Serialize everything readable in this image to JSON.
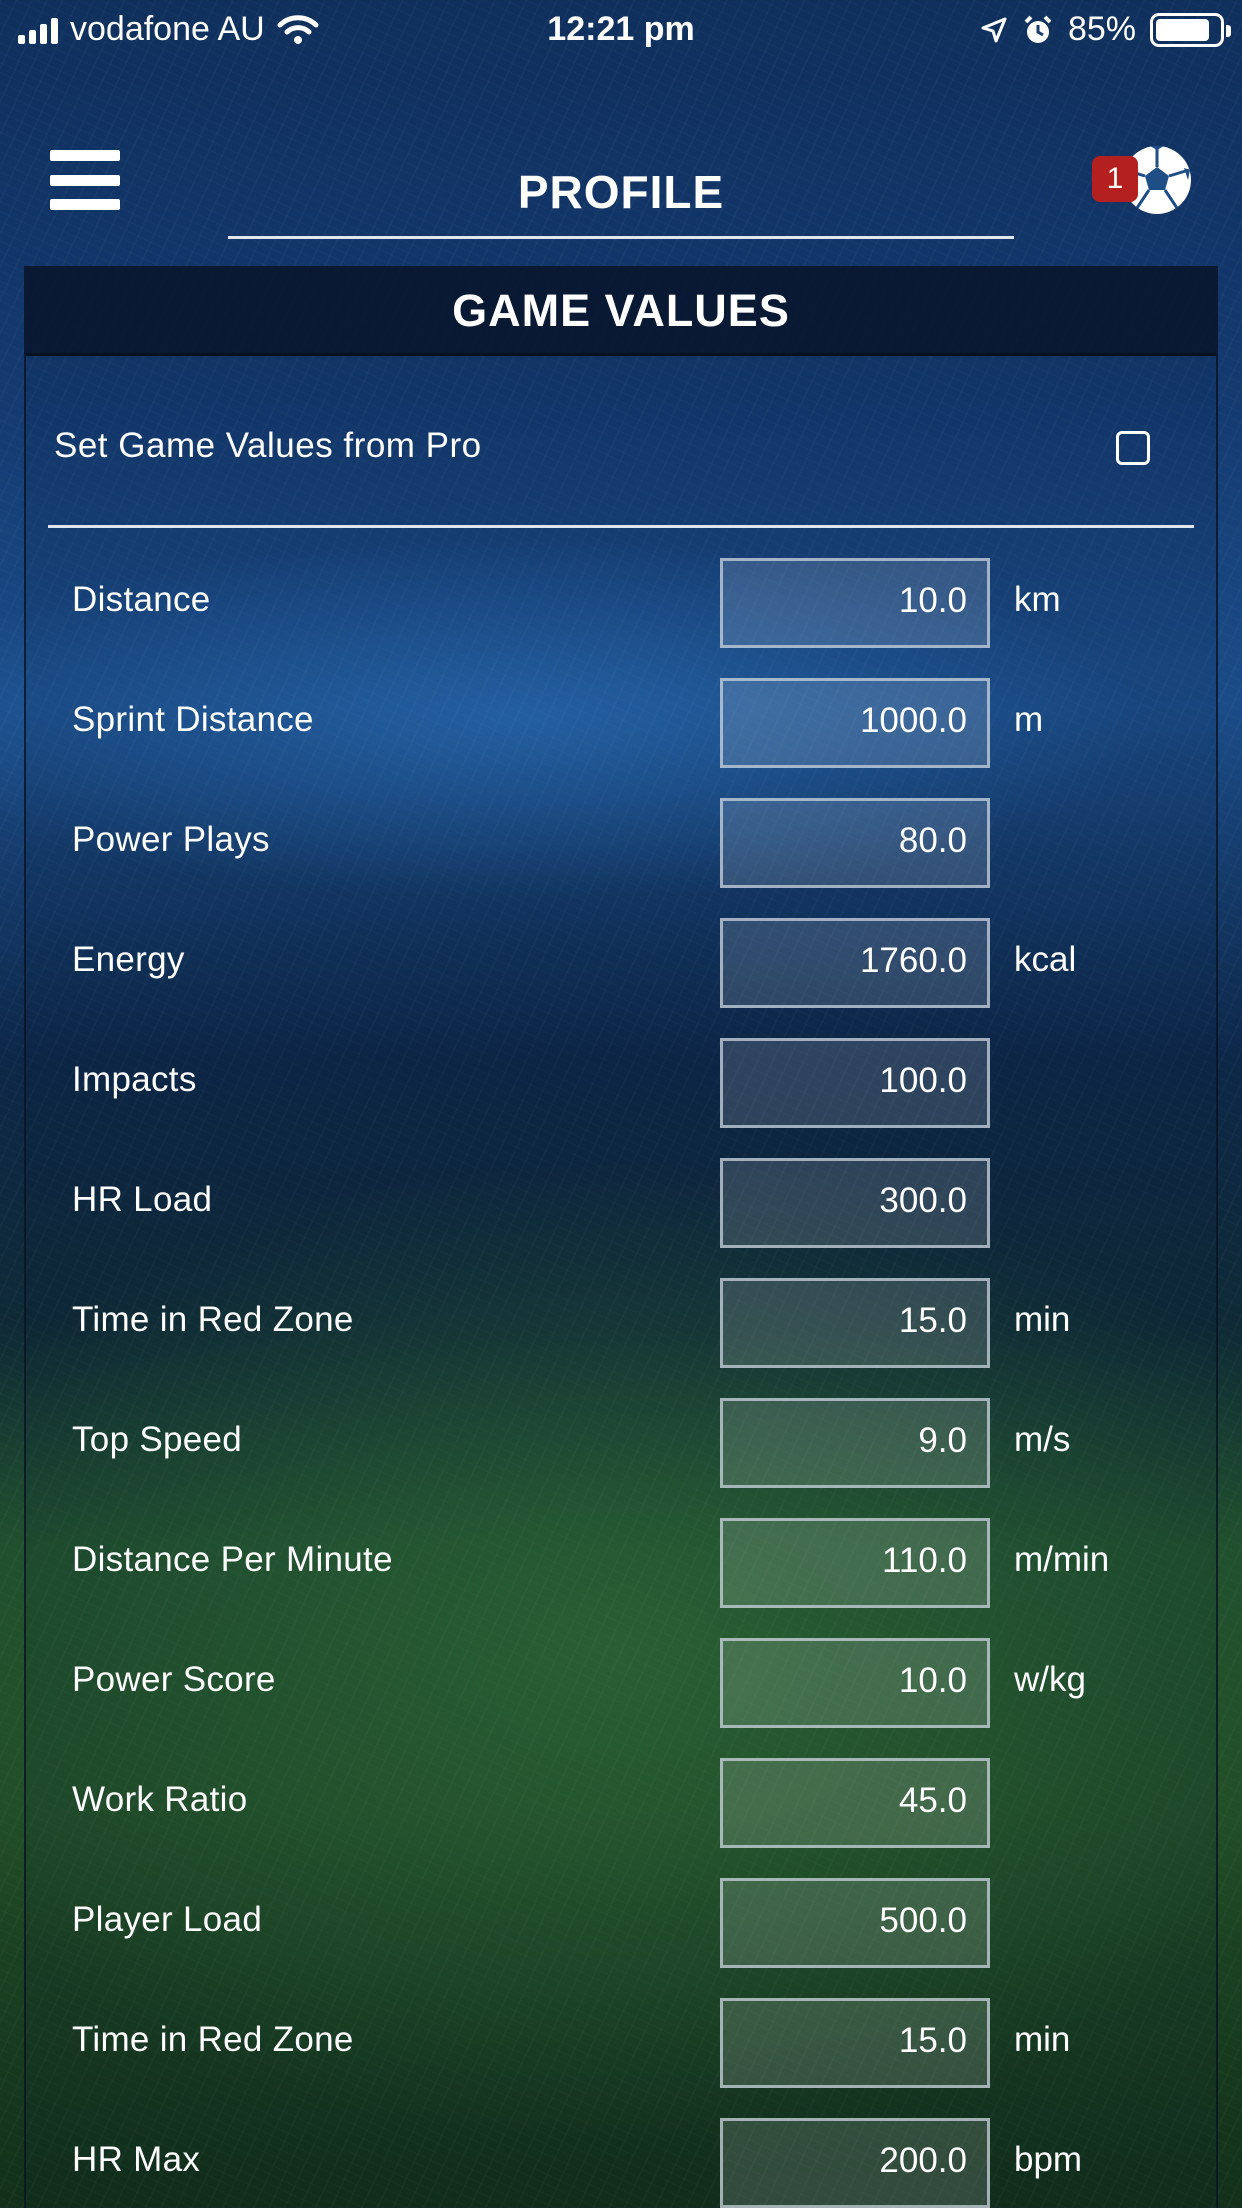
{
  "status_bar": {
    "carrier": "vodafone AU",
    "time": "12:21 pm",
    "battery_percent": "85%",
    "battery_level": 0.85
  },
  "header": {
    "title": "PROFILE",
    "notification_count": "1"
  },
  "panel": {
    "title": "GAME VALUES",
    "pro_label": "Set Game Values from Pro",
    "pro_checked": false
  },
  "rows": [
    {
      "label": "Distance",
      "value": "10.0",
      "unit": "km"
    },
    {
      "label": "Sprint Distance",
      "value": "1000.0",
      "unit": "m"
    },
    {
      "label": "Power Plays",
      "value": "80.0",
      "unit": ""
    },
    {
      "label": "Energy",
      "value": "1760.0",
      "unit": "kcal"
    },
    {
      "label": "Impacts",
      "value": "100.0",
      "unit": ""
    },
    {
      "label": "HR Load",
      "value": "300.0",
      "unit": ""
    },
    {
      "label": "Time in Red Zone",
      "value": "15.0",
      "unit": "min"
    },
    {
      "label": "Top Speed",
      "value": "9.0",
      "unit": "m/s"
    },
    {
      "label": "Distance Per Minute",
      "value": "110.0",
      "unit": "m/min"
    },
    {
      "label": "Power Score",
      "value": "10.0",
      "unit": "w/kg"
    },
    {
      "label": "Work Ratio",
      "value": "45.0",
      "unit": ""
    },
    {
      "label": "Player Load",
      "value": "500.0",
      "unit": ""
    },
    {
      "label": "Time in Red Zone",
      "value": "15.0",
      "unit": "min"
    },
    {
      "label": "HR Max",
      "value": "200.0",
      "unit": "bpm"
    }
  ]
}
